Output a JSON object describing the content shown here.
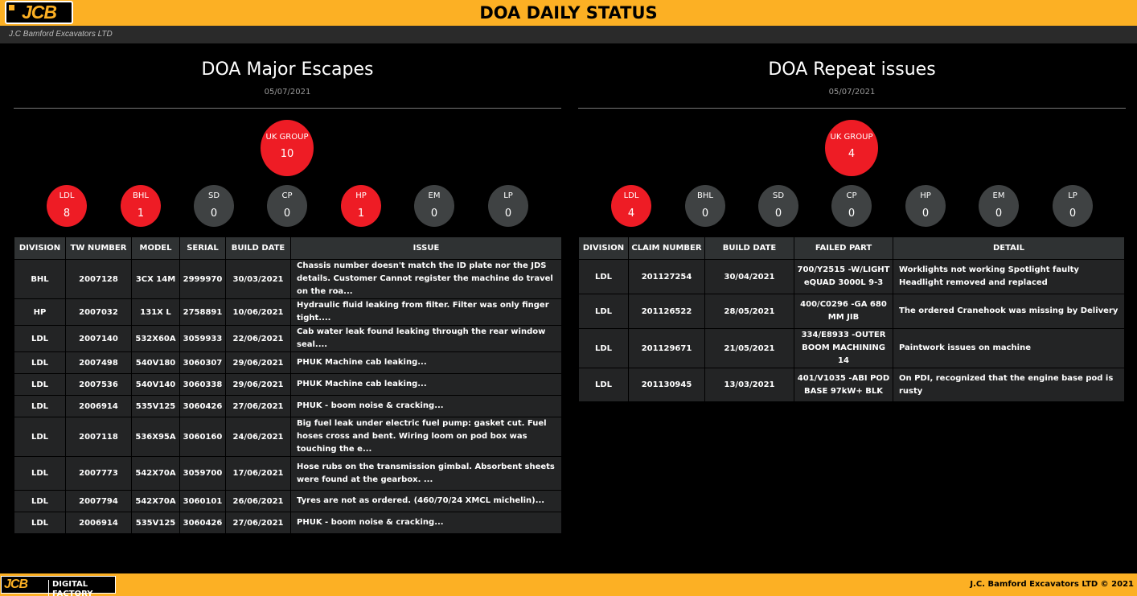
{
  "header": {
    "logo_text": "JCB",
    "title": "DOA DAILY STATUS",
    "company": "J.C Bamford Excavators LTD"
  },
  "left_panel": {
    "title": "DOA Major Escapes",
    "date": "05/07/2021",
    "group": {
      "label": "UK GROUP",
      "value": "10"
    },
    "divisions": [
      {
        "label": "LDL",
        "value": "8"
      },
      {
        "label": "BHL",
        "value": "1"
      },
      {
        "label": "SD",
        "value": "0"
      },
      {
        "label": "CP",
        "value": "0"
      },
      {
        "label": "HP",
        "value": "1"
      },
      {
        "label": "EM",
        "value": "0"
      },
      {
        "label": "LP",
        "value": "0"
      }
    ],
    "columns": [
      "DIVISION",
      "TW NUMBER",
      "MODEL",
      "SERIAL",
      "BUILD DATE",
      "ISSUE"
    ],
    "rows": [
      [
        "BHL",
        "2007128",
        "3CX 14M",
        "2999970",
        "30/03/2021",
        "Chassis number doesn't match the ID plate nor the JDS details. Customer Cannot register the machine do travel on the roa..."
      ],
      [
        "HP",
        "2007032",
        "131X L",
        "2758891",
        "10/06/2021",
        "Hydraulic fluid leaking from filter. Filter was only finger tight...."
      ],
      [
        "LDL",
        "2007140",
        "532X60A",
        "3059933",
        "22/06/2021",
        "Cab water leak found leaking through the rear window seal...."
      ],
      [
        "LDL",
        "2007498",
        "540V180",
        "3060307",
        "29/06/2021",
        "PHUK Machine cab leaking..."
      ],
      [
        "LDL",
        "2007536",
        "540V140",
        "3060338",
        "29/06/2021",
        "PHUK Machine cab leaking..."
      ],
      [
        "LDL",
        "2006914",
        "535V125",
        "3060426",
        "27/06/2021",
        "PHUK - boom noise & cracking..."
      ],
      [
        "LDL",
        "2007118",
        "536X95A",
        "3060160",
        "24/06/2021",
        "Big fuel leak under electric fuel pump: gasket cut. Fuel hoses cross and bent. Wiring loom on pod box was touching the e..."
      ],
      [
        "LDL",
        "2007773",
        "542X70A",
        "3059700",
        "17/06/2021",
        "Hose rubs on the transmission gimbal. Absorbent sheets were found at the gearbox. ..."
      ],
      [
        "LDL",
        "2007794",
        "542X70A",
        "3060101",
        "26/06/2021",
        "Tyres are not as ordered. (460/70/24 XMCL michelin)..."
      ],
      [
        "LDL",
        "2006914",
        "535V125",
        "3060426",
        "27/06/2021",
        "PHUK - boom noise & cracking..."
      ]
    ]
  },
  "right_panel": {
    "title": "DOA Repeat issues",
    "date": "05/07/2021",
    "group": {
      "label": "UK GROUP",
      "value": "4"
    },
    "divisions": [
      {
        "label": "LDL",
        "value": "4"
      },
      {
        "label": "BHL",
        "value": "0"
      },
      {
        "label": "SD",
        "value": "0"
      },
      {
        "label": "CP",
        "value": "0"
      },
      {
        "label": "HP",
        "value": "0"
      },
      {
        "label": "EM",
        "value": "0"
      },
      {
        "label": "LP",
        "value": "0"
      }
    ],
    "columns": [
      "DIVISION",
      "CLAIM NUMBER",
      "BUILD DATE",
      "FAILED PART",
      "DETAIL"
    ],
    "rows": [
      [
        "LDL",
        "201127254",
        "30/04/2021",
        "700/Y2515 -W/LIGHT eQUAD 3000L 9-3",
        "Worklights not working Spotlight faulty Headlight removed and replaced"
      ],
      [
        "LDL",
        "201126522",
        "28/05/2021",
        "400/C0296 -GA 680 MM JIB",
        "The ordered Cranehook was missing by Delivery"
      ],
      [
        "LDL",
        "201129671",
        "21/05/2021",
        "334/E8933 -OUTER BOOM MACHINING 14",
        "Paintwork issues on machine"
      ],
      [
        "LDL",
        "201130945",
        "13/03/2021",
        "401/V1035 -ABI POD BASE 97kW+ BLK",
        "On PDI, recognized that the engine base pod is rusty"
      ]
    ]
  },
  "footer": {
    "logo_text": "JCB",
    "logo_suffix": "DIGITAL FACTORY",
    "copyright": "J.C. Bamford Excavators LTD © 2021"
  },
  "colors": {
    "brand_yellow": "#fcb024",
    "alert_red": "#ee1c25",
    "neutral_circle": "#3f4243",
    "header_cell": "#2f3233",
    "body_cell": "#232425"
  }
}
